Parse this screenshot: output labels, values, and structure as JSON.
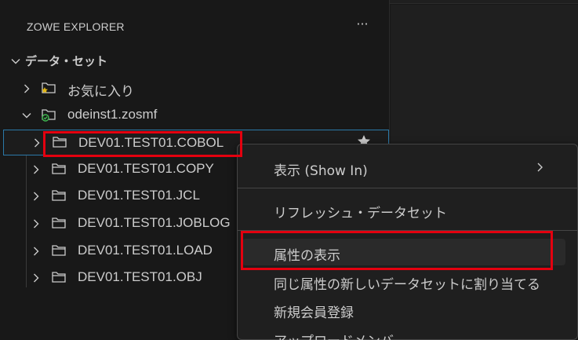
{
  "explorer": {
    "title": "ZOWE EXPLORER",
    "more_label": "···"
  },
  "tree": {
    "section_label": "データ・セット",
    "favorites_label": "お気に入り",
    "profile_label": "odeinst1.zosmf",
    "datasets": [
      "DEV01.TEST01.COBOL",
      "DEV01.TEST01.COPY",
      "DEV01.TEST01.JCL",
      "DEV01.TEST01.JOBLOG",
      "DEV01.TEST01.LOAD",
      "DEV01.TEST01.OBJ"
    ]
  },
  "context_menu": {
    "show_in": "表示 (Show In)",
    "refresh": "リフレッシュ・データセット",
    "show_attributes": "属性の表示",
    "allocate_like": "同じ属性の新しいデータセットに割り当てる",
    "new_member": "新規会員登録",
    "upload_member": "アップロードメンバ"
  },
  "colors": {
    "highlight": "#e4000f",
    "selection_border": "#2b79a8",
    "star": "#e2b714",
    "profile_badge": "#3fb950"
  }
}
